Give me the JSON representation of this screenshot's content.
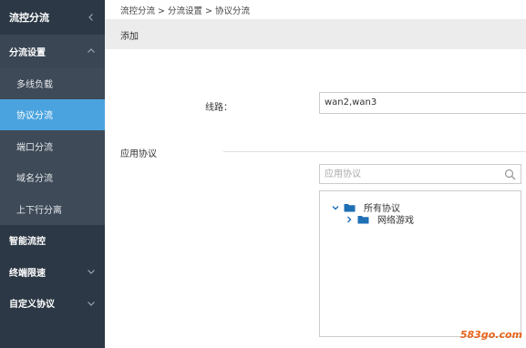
{
  "sidebar": {
    "title": "流控分流",
    "groups": [
      {
        "label": "分流设置"
      },
      {
        "label": "智能流控"
      },
      {
        "label": "终端限速"
      },
      {
        "label": "自定义协议"
      }
    ],
    "sub_items": [
      {
        "label": "多线负载"
      },
      {
        "label": "协议分流"
      },
      {
        "label": "端口分流"
      },
      {
        "label": "域名分流"
      },
      {
        "label": "上下行分离"
      }
    ],
    "active_item": "协议分流"
  },
  "breadcrumb": {
    "items": [
      "流控分流",
      "分流设置",
      "协议分流"
    ],
    "separator": ">"
  },
  "header": {
    "title": "添加"
  },
  "form": {
    "line_label": "线路：",
    "line_value": "wan2,wan3",
    "section_label": "应用协议",
    "search_placeholder": "应用协议",
    "tree": {
      "root": "所有协议",
      "children": [
        "网络游戏"
      ]
    }
  },
  "watermark": "583go.com",
  "colors": {
    "sidebar_bg": "#2c3845",
    "active": "#4aa3df",
    "folder": "#1f6fb5",
    "watermark": "#e8641a"
  }
}
